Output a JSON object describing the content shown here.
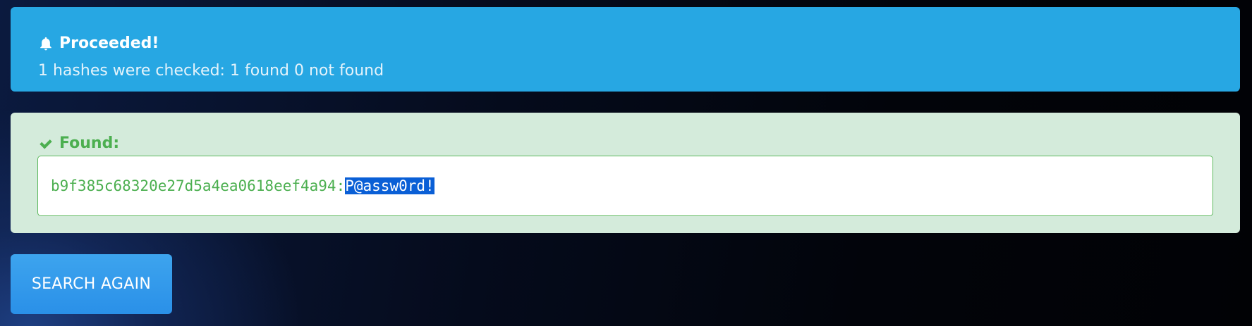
{
  "info_alert": {
    "icon": "bell-icon",
    "title": "Proceeded!",
    "message": "1 hashes were checked: 1 found 0 not found",
    "color": "#27a7e3"
  },
  "found_alert": {
    "icon": "check-icon",
    "title": "Found:",
    "hash": "b9f385c68320e27d5a4ea0618eef4a94",
    "separator": ":",
    "password": "P@assw0rd!",
    "color": "#4caf50",
    "background": "#d4ebdb"
  },
  "actions": {
    "search_again_label": "SEARCH AGAIN"
  },
  "colors": {
    "button": "#2a90e8",
    "selection": "#0a5fd6"
  }
}
